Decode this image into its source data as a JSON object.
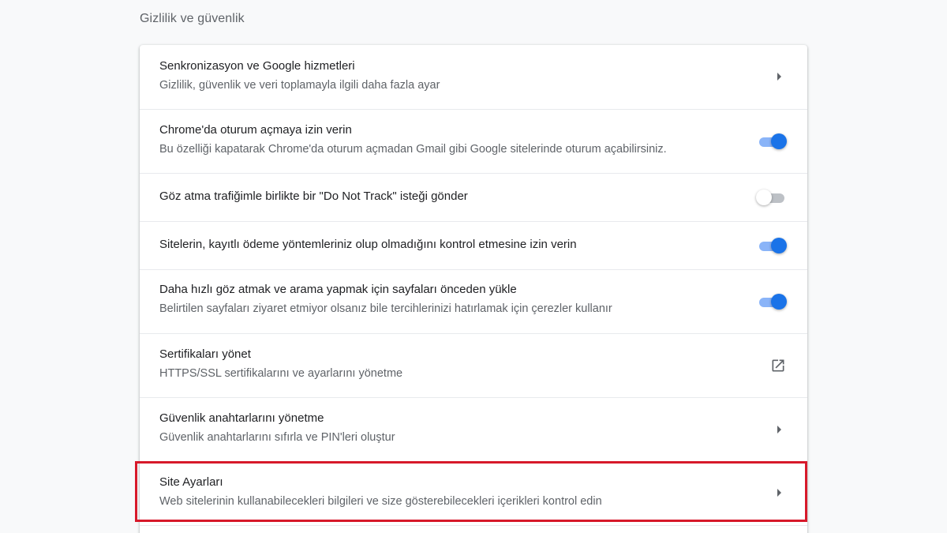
{
  "section": {
    "title": "Gizlilik ve güvenlik"
  },
  "colors": {
    "toggle_on": "#1a73e8",
    "toggle_on_track": "#8ab4f8",
    "highlight_border": "#d7192a"
  },
  "rows": [
    {
      "label": "Senkronizasyon ve Google hizmetleri",
      "sublabel": "Gizlilik, güvenlik ve veri toplamayla ilgili daha fazla ayar",
      "control": "arrow-right-icon"
    },
    {
      "label": "Chrome'da oturum açmaya izin verin",
      "sublabel": "Bu özelliği kapatarak Chrome'da oturum açmadan Gmail gibi Google sitelerinde oturum açabilirsiniz.",
      "control": "toggle",
      "checked": true
    },
    {
      "label": "Göz atma trafiğimle birlikte bir \"Do Not Track\" isteği gönder",
      "control": "toggle",
      "checked": false
    },
    {
      "label": "Sitelerin, kayıtlı ödeme yöntemleriniz olup olmadığını kontrol etmesine izin verin",
      "control": "toggle",
      "checked": true
    },
    {
      "label": "Daha hızlı göz atmak ve arama yapmak için sayfaları önceden yükle",
      "sublabel": "Belirtilen sayfaları ziyaret etmiyor olsanız bile tercihlerinizi hatırlamak için çerezler kullanır",
      "control": "toggle",
      "checked": true
    },
    {
      "label": "Sertifikaları yönet",
      "sublabel": "HTTPS/SSL sertifikalarını ve ayarlarını yönetme",
      "control": "open-in-new-icon"
    },
    {
      "label": "Güvenlik anahtarlarını yönetme",
      "sublabel": "Güvenlik anahtarlarını sıfırla ve PIN'leri oluştur",
      "control": "arrow-right-icon"
    },
    {
      "label": "Site Ayarları",
      "sublabel": "Web sitelerinin kullanabilecekleri bilgileri ve size gösterebilecekleri içerikleri kontrol edin",
      "control": "arrow-right-icon",
      "highlighted": true
    }
  ]
}
